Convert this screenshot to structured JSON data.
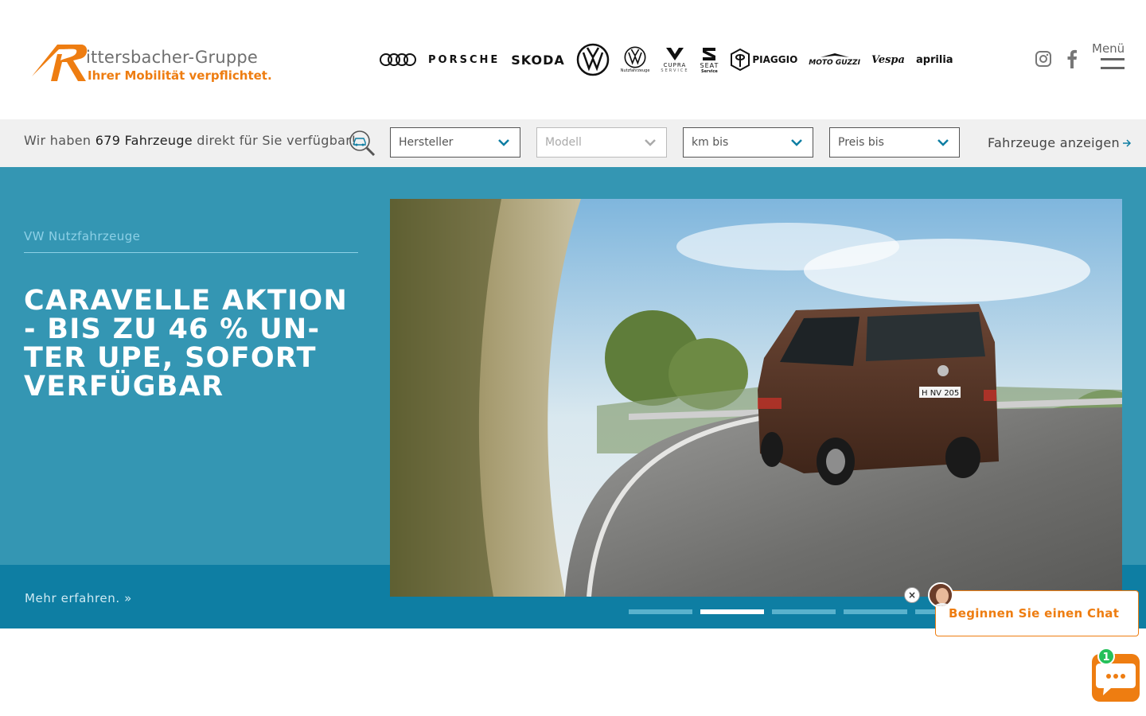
{
  "header": {
    "logo_title": "ittersbacher-Gruppe",
    "logo_tagline": "Ihrer Mobilität verpflichtet.",
    "brands": [
      {
        "name": "audi-logo",
        "label": ""
      },
      {
        "name": "porsche-logo",
        "label": "PORSCHE"
      },
      {
        "name": "skoda-logo",
        "label": "SKODA"
      },
      {
        "name": "vw-logo",
        "label": ""
      },
      {
        "name": "vw-nutzfahrzeuge-logo",
        "label": "Nutzfahrzeuge"
      },
      {
        "name": "cupra-logo",
        "label": "CUPRA"
      },
      {
        "name": "seat-logo",
        "label": "SEAT"
      },
      {
        "name": "piaggio-logo",
        "label": "PIAGGIO"
      },
      {
        "name": "moto-guzzi-logo",
        "label": "MOTO GUZZI"
      },
      {
        "name": "vespa-logo",
        "label": "Vespa"
      },
      {
        "name": "aprilia-logo",
        "label": "aprilia"
      }
    ],
    "cupra_sub": "SERVICE",
    "seat_sub": "Service",
    "menu_label": "Menü",
    "social_icons": [
      "instagram-icon",
      "facebook-icon"
    ]
  },
  "search": {
    "prefix": "Wir haben ",
    "count": "679 Fahrzeuge",
    "suffix": " direkt für Sie verfügbar!",
    "filters": {
      "manufacturer": "Hersteller",
      "model": "Modell",
      "km": "km bis",
      "price": "Preis bis"
    },
    "show_link": "Fahrzeuge anzeigen"
  },
  "hero": {
    "eyebrow": "VW Nutzfahrzeuge",
    "headline": "CARAVELLE AKTION - BIS ZU 46 % UN-TER UPE, SOFORT VERFÜGBAR",
    "more": "Mehr erfahren. »",
    "plate": "H NV 205",
    "slides": 5,
    "active_slide": 2
  },
  "chat": {
    "cta": "Beginnen Sie einen Chat",
    "badge": "1",
    "close": "×"
  },
  "colors": {
    "accent": "#ee7d11",
    "hero": "#3496b3",
    "hero_dark": "#0e7ea3"
  }
}
